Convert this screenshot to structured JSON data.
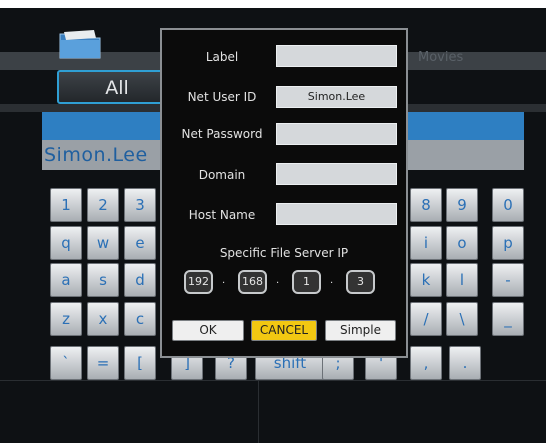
{
  "background": {
    "tab_label": "All",
    "category_label": "Movies",
    "input_value": "Simon.Lee",
    "keyboard": [
      [
        "1",
        "2",
        "3",
        "",
        "",
        "",
        "",
        "8",
        "9",
        "0"
      ],
      [
        "q",
        "w",
        "e",
        "",
        "",
        "",
        "",
        "i",
        "o",
        "p"
      ],
      [
        "a",
        "s",
        "d",
        "",
        "",
        "",
        "",
        "k",
        "l",
        "-"
      ],
      [
        "z",
        "x",
        "c",
        "",
        "",
        "",
        "",
        "/",
        "\\",
        "_"
      ],
      [
        "`",
        "=",
        "[",
        "]",
        "?",
        "shift",
        ";",
        "'",
        ",",
        "."
      ]
    ]
  },
  "dialog": {
    "label_label": "Label",
    "label_value": "",
    "net_user_id_label": "Net User ID",
    "net_user_id_value": "Simon.Lee",
    "net_password_label": "Net Password",
    "net_password_value": "",
    "domain_label": "Domain",
    "domain_value": "",
    "host_name_label": "Host Name",
    "host_name_value": "",
    "ip_title": "Specific File Server IP",
    "ip": [
      "192",
      "168",
      "1",
      "3"
    ],
    "ip_separator": "·",
    "ok_label": "OK",
    "cancel_label": "CANCEL",
    "simple_label": "Simple"
  },
  "colors": {
    "accent_blue": "#2e7fc2",
    "selected_button": "#f2c812"
  }
}
